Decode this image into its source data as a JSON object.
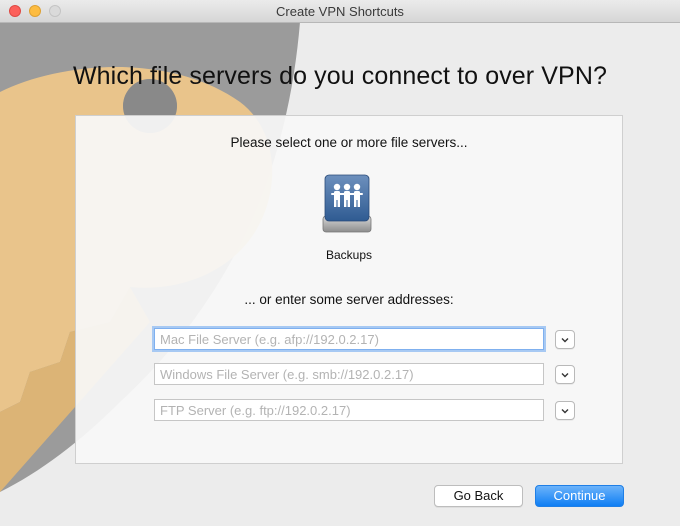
{
  "window": {
    "title": "Create VPN Shortcuts"
  },
  "heading": "Which file servers do you connect to over VPN?",
  "panel": {
    "prompt": "Please select one or more file servers...",
    "server": {
      "label": "Backups",
      "icon": "network-server-icon"
    },
    "manual_prompt": "... or enter some server addresses:",
    "fields": [
      {
        "placeholder": "Mac File Server (e.g. afp://192.0.2.17)",
        "value": ""
      },
      {
        "placeholder": "Windows File Server (e.g. smb://192.0.2.17)",
        "value": ""
      },
      {
        "placeholder": "FTP Server (e.g. ftp://192.0.2.17)",
        "value": ""
      }
    ]
  },
  "buttons": {
    "back": "Go Back",
    "continue": "Continue"
  },
  "colors": {
    "accent": "#0f7ef4",
    "close": "#fc605b",
    "minimize": "#fdbc40",
    "key_art": "#f2c98a"
  }
}
